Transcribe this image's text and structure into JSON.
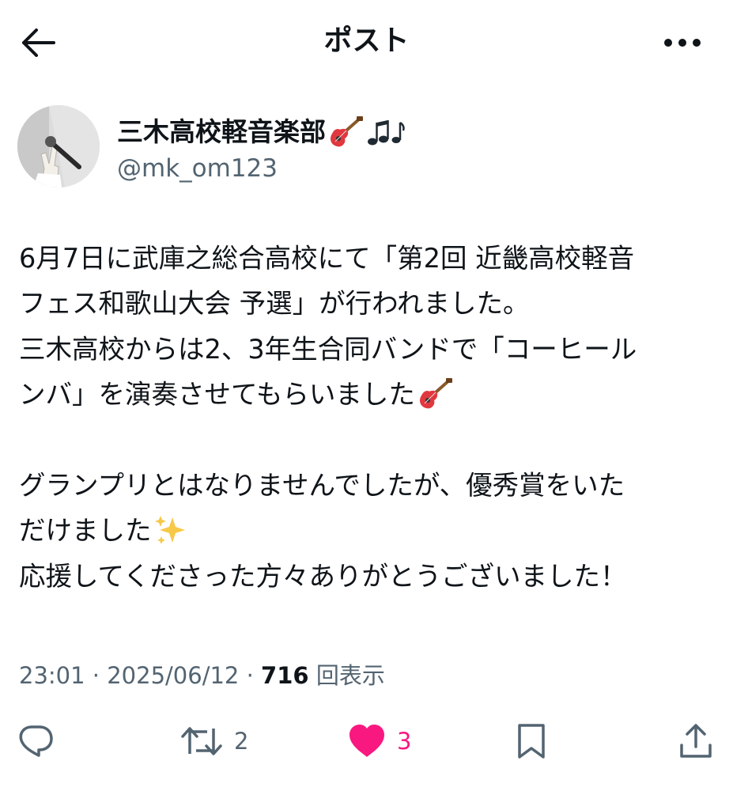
{
  "header": {
    "title": "ポスト",
    "back_icon": "arrow-left-icon",
    "more_icon": "more-horizontal-icon"
  },
  "author": {
    "display_name": "三木高校軽音楽部",
    "name_emojis": [
      "guitar-icon",
      "music-notes-icon"
    ],
    "handle": "@mk_om123"
  },
  "tweet": {
    "lines": [
      "6月7日に武庫之総合高校にて「第2回 近畿高校軽音",
      "フェス和歌山大会 予選」が行われました。",
      "三木高校からは2、3年生合同バンドで「コーヒール",
      "ンバ」を演奏させてもらいました",
      "",
      "グランプリとはなりませんでしたが、優秀賞をいた",
      "だけました",
      "応援してくださった方々ありがとうございました！"
    ],
    "line_emojis": {
      "3": "guitar-icon",
      "6": "sparkles-icon"
    }
  },
  "meta": {
    "time": "23:01",
    "separator": " · ",
    "date": "2025/06/12",
    "views_count": "716",
    "views_label": "回表示"
  },
  "actions": {
    "reply": {
      "icon": "reply-icon",
      "count": ""
    },
    "repost": {
      "icon": "repost-icon",
      "count": "2"
    },
    "like": {
      "icon": "heart-filled-icon",
      "count": "3",
      "liked": true
    },
    "bookmark": {
      "icon": "bookmark-icon"
    },
    "share": {
      "icon": "share-icon"
    }
  },
  "colors": {
    "text_primary": "#0f1419",
    "text_secondary": "#536471",
    "like_pink": "#f91880"
  }
}
